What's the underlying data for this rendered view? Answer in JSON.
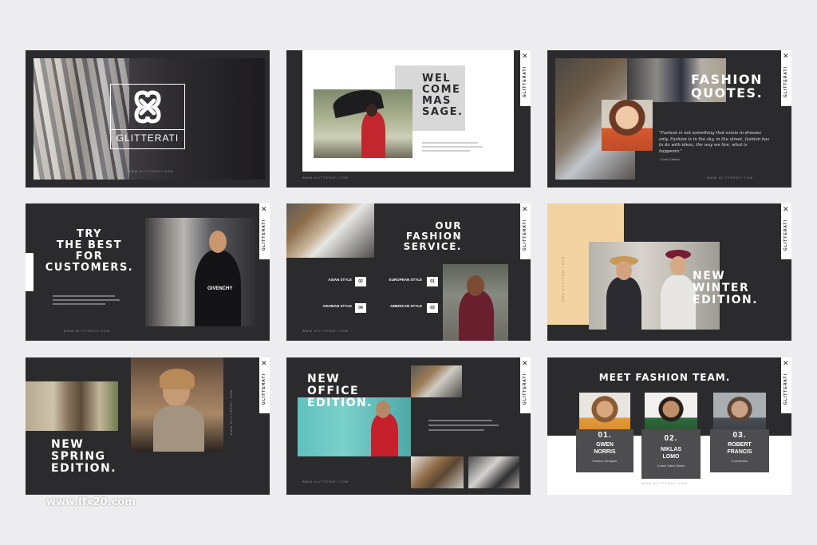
{
  "brand": "GLITTERATI",
  "footer": "WWW.GLITTERATI.COM",
  "watermark": "www.lfx20.com",
  "slide_welcome": {
    "title": [
      "WEL",
      "COME",
      "MAS",
      "SAGE."
    ]
  },
  "slide_quotes": {
    "title": [
      "FASHION",
      "QUOTES."
    ],
    "quote": "\"Fashion is not something that exists in dresses only. Fashion is in the sky, in the street, fashion has to do with ideas, the way we live, what is happenin.\"",
    "author": "- Coco Chanel"
  },
  "slide_try": {
    "title": [
      "TRY",
      "THE BEST",
      "FOR",
      "CUSTOMERS."
    ]
  },
  "slide_service": {
    "title": [
      "OUR",
      "FASHION",
      "SERVICE."
    ],
    "items": [
      {
        "label": "ASIAN STYLE",
        "num": "02"
      },
      {
        "label": "EUROPEAN STYLE",
        "num": "01"
      },
      {
        "label": "ARABIAN STYLE",
        "num": "04"
      },
      {
        "label": "AMERICAN STYLE",
        "num": "03"
      }
    ]
  },
  "slide_winter": {
    "title": [
      "NEW",
      "WINTER",
      "EDITION."
    ]
  },
  "slide_spring": {
    "title": [
      "NEW",
      "SPRING",
      "EDITION."
    ]
  },
  "slide_office": {
    "title": [
      "NEW",
      "OFFICE",
      "EDITION."
    ]
  },
  "slide_team": {
    "title": "MEET FASHION TEAM.",
    "members": [
      {
        "num": "01.",
        "first": "GWEN",
        "last": "NORRIS",
        "role": "Fashion Designer"
      },
      {
        "num": "02.",
        "first": "NIKLAS",
        "last": "LOMO",
        "role": "Coach Sales Model"
      },
      {
        "num": "03.",
        "first": "ROBERT",
        "last": "FRANCIS",
        "role": "Coordinator"
      }
    ]
  },
  "colors": {
    "dark": "#2b2a2c",
    "accent_peach": "#f3d3a2",
    "bg": "#ededef"
  }
}
